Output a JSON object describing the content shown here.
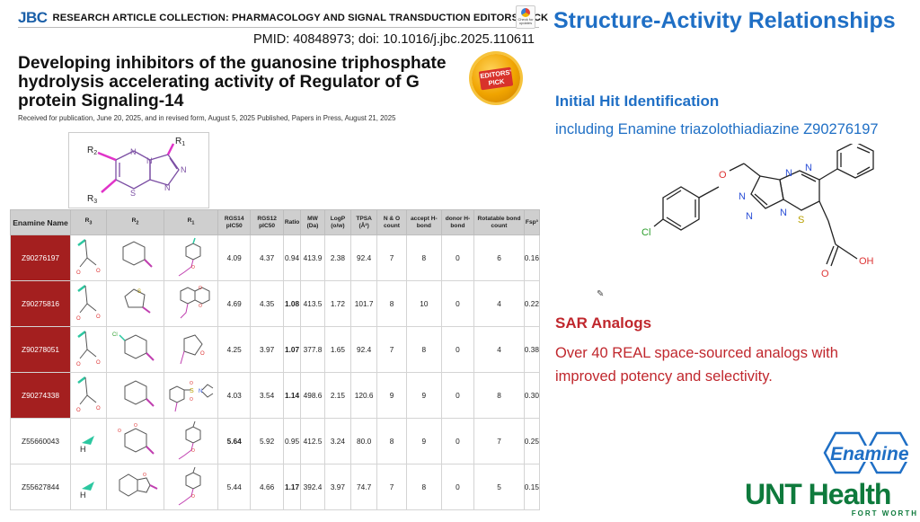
{
  "journal": {
    "logo": "JBC",
    "collection": "RESEARCH ARTICLE COLLECTION: PHARMACOLOGY AND SIGNAL TRANSDUCTION EDITORS' PICK",
    "check_updates": "Check for updates",
    "pmid": "PMID: 40848973; doi: 10.1016/j.jbc.2025.110611",
    "title": "Developing inhibitors of the guanosine triphosphate hydrolysis accelerating activity of Regulator of G protein Signaling-14",
    "received": "Received for publication, June 20, 2025, and in revised form, August 5, 2025  Published, Papers in Press, August 21, 2025",
    "badge": "EDITORS' PICK"
  },
  "scaffold_labels": {
    "r1": "R",
    "r2": "R",
    "r3": "R",
    "sub": "1",
    "sub2": "2",
    "sub3": "3",
    "s": "S",
    "n": "N"
  },
  "table": {
    "headers": {
      "name": "Enamine Name",
      "r3": "R",
      "r3_sub": "3",
      "r2": "R",
      "r2_sub": "2",
      "r1": "R",
      "r1_sub": "1",
      "rgs14": "RGS14 pIC50",
      "rgs12": "RGS12 pIC50",
      "ratio": "Ratio",
      "mw": "MW (Da)",
      "logp": "LogP (o/w)",
      "tpsa": "TPSA (Å²)",
      "no_count": "N & O count",
      "accept": "accept H-bond",
      "donor": "donor H-bond",
      "rotatable": "Rotatable bond count",
      "fsp": "Fsp³"
    },
    "rows": [
      {
        "name": "Z90276197",
        "rgs14": "4.09",
        "rgs12": "4.37",
        "ratio": "0.94",
        "mw": "413.9",
        "logp": "2.38",
        "tpsa": "92.4",
        "no": "7",
        "acc": "8",
        "don": "0",
        "rot": "6",
        "fsp": "0.16"
      },
      {
        "name": "Z90275816",
        "rgs14": "4.69",
        "rgs12": "4.35",
        "ratio": "1.08",
        "mw": "413.5",
        "logp": "1.72",
        "tpsa": "101.7",
        "no": "8",
        "acc": "10",
        "don": "0",
        "rot": "4",
        "fsp": "0.22"
      },
      {
        "name": "Z90278051",
        "rgs14": "4.25",
        "rgs12": "3.97",
        "ratio": "1.07",
        "mw": "377.8",
        "logp": "1.65",
        "tpsa": "92.4",
        "no": "7",
        "acc": "8",
        "don": "0",
        "rot": "4",
        "fsp": "0.38"
      },
      {
        "name": "Z90274338",
        "rgs14": "4.03",
        "rgs12": "3.54",
        "ratio": "1.14",
        "mw": "498.6",
        "logp": "2.15",
        "tpsa": "120.6",
        "no": "9",
        "acc": "9",
        "don": "0",
        "rot": "8",
        "fsp": "0.30"
      },
      {
        "name": "Z55660043",
        "rgs14": "5.64",
        "rgs12": "5.92",
        "ratio": "0.95",
        "mw": "412.5",
        "logp": "3.24",
        "tpsa": "80.0",
        "no": "8",
        "acc": "9",
        "don": "0",
        "rot": "7",
        "fsp": "0.25"
      },
      {
        "name": "Z55627844",
        "rgs14": "5.44",
        "rgs12": "4.66",
        "ratio": "1.17",
        "mw": "392.4",
        "logp": "3.97",
        "tpsa": "74.7",
        "no": "7",
        "acc": "8",
        "don": "0",
        "rot": "5",
        "fsp": "0.15"
      }
    ],
    "structure_labels": {
      "h": "H",
      "o": "O",
      "s": "S",
      "n": "N",
      "cl": "Cl"
    }
  },
  "slide": {
    "title": "Structure-Activity Relationships",
    "initial_hit": "Initial Hit Identification",
    "including": "including ",
    "hit_name": "Enamine triazolothiadiazine Z90276197",
    "sar_head": "SAR Analogs",
    "sar_body": "Over 40 REAL space-sourced analogs with improved potency and selectivity.",
    "molecule_labels": {
      "o": "O",
      "n1": "N",
      "n2": "N",
      "n3": "N",
      "n4": "N",
      "n5": "N",
      "s": "S",
      "cl": "Cl",
      "oh": "OH",
      "o2": "O"
    }
  },
  "logos": {
    "enamine": "Enamine",
    "unt": "UNT Health",
    "fort_worth": "FORT WORTH"
  },
  "colors": {
    "slide_blue": "#1f6fc5",
    "slide_red": "#c0272d",
    "table_highlight": "#a41f1f",
    "unt_green": "#0e7a3c",
    "jbc_blue": "#1a5fa8"
  }
}
